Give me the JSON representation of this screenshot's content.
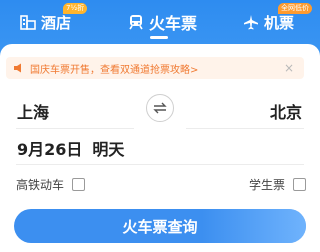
{
  "tabs": {
    "hotel": {
      "label": "酒店",
      "badge": "7½折"
    },
    "train": {
      "label": "火车票"
    },
    "flight": {
      "label": "机票",
      "badge": "全网低价"
    }
  },
  "notice": {
    "text": "国庆车票开售，查看双通道抢票攻略>",
    "close": "×"
  },
  "route": {
    "from": "上海",
    "to": "北京"
  },
  "date": {
    "day": "9月26日",
    "relative": "明天"
  },
  "options": {
    "high_speed": "高铁动车",
    "student": "学生票"
  },
  "search_button": "火车票查询",
  "colors": {
    "primary": "#3b96f3",
    "notice_text": "#f07a32",
    "notice_bg": "#fff3ea",
    "badge": "#ffb52e"
  },
  "icons": {
    "hotel": "hotel-icon",
    "train": "train-icon",
    "flight": "plane-icon",
    "notice": "speaker-icon",
    "swap": "swap-icon"
  }
}
